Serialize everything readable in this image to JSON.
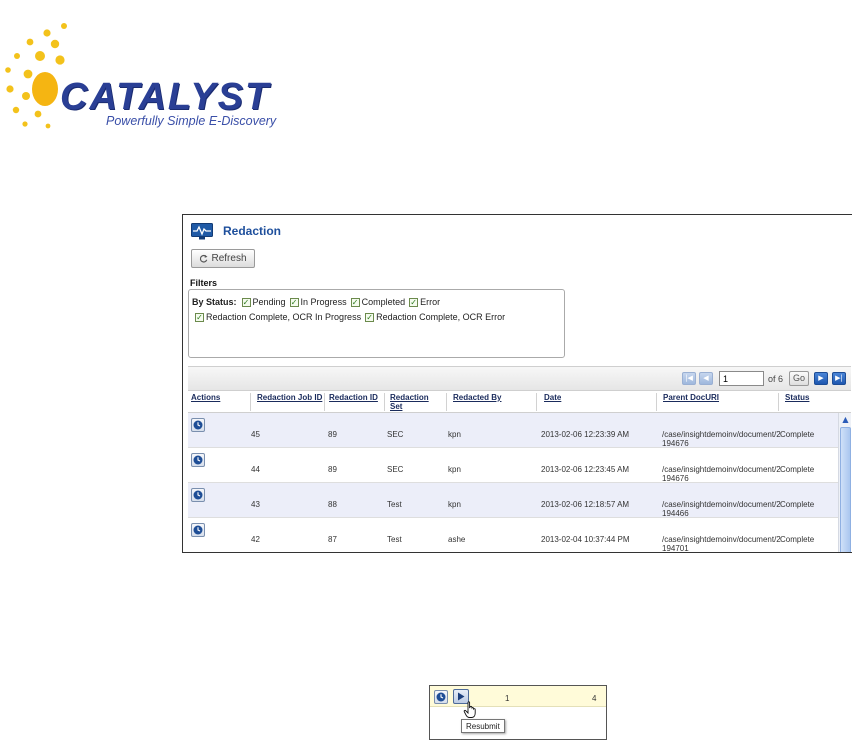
{
  "logo": {
    "name": "CATALYST",
    "tagline": "Powerfully Simple E-Discovery",
    "brand_color": "#2a3f95",
    "sun_color": "#f3c21b"
  },
  "panel": {
    "title": "Redaction",
    "refresh_label": "Refresh",
    "filters_label": "Filters",
    "by_status_label": "By Status:",
    "statuses": [
      {
        "label": "Pending",
        "checked": true
      },
      {
        "label": "In Progress",
        "checked": true
      },
      {
        "label": "Completed",
        "checked": true
      },
      {
        "label": "Error",
        "checked": true
      },
      {
        "label": "Redaction Complete, OCR In Progress",
        "checked": true
      },
      {
        "label": "Redaction Complete, OCR Error",
        "checked": true
      }
    ]
  },
  "pager": {
    "page": "1",
    "of_label": "of 6",
    "go_label": "Go"
  },
  "table": {
    "columns": [
      "Actions",
      "Redaction Job ID",
      "Redaction ID",
      "Redaction Set",
      "Redacted By",
      "Date",
      "Parent DocURI",
      "Status"
    ],
    "rows": [
      {
        "job_id": "45",
        "redaction_id": "89",
        "set": "SEC",
        "by": "kpn",
        "date": "2013-02-06 12:23:39 AM",
        "uri": "/case/insightdemoinv/document/2 194676",
        "status": "Complete"
      },
      {
        "job_id": "44",
        "redaction_id": "89",
        "set": "SEC",
        "by": "kpn",
        "date": "2013-02-06 12:23:45 AM",
        "uri": "/case/insightdemoinv/document/2 194676",
        "status": "Complete"
      },
      {
        "job_id": "43",
        "redaction_id": "88",
        "set": "Test",
        "by": "kpn",
        "date": "2013-02-06 12:18:57 AM",
        "uri": "/case/insightdemoinv/document/2 194466",
        "status": "Complete"
      },
      {
        "job_id": "42",
        "redaction_id": "87",
        "set": "Test",
        "by": "ashe",
        "date": "2013-02-04 10:37:44 PM",
        "uri": "/case/insightdemoinv/document/2 194701",
        "status": "Complete"
      }
    ]
  },
  "inset": {
    "value_1": "1",
    "value_2": "4",
    "tooltip": "Resubmit"
  }
}
